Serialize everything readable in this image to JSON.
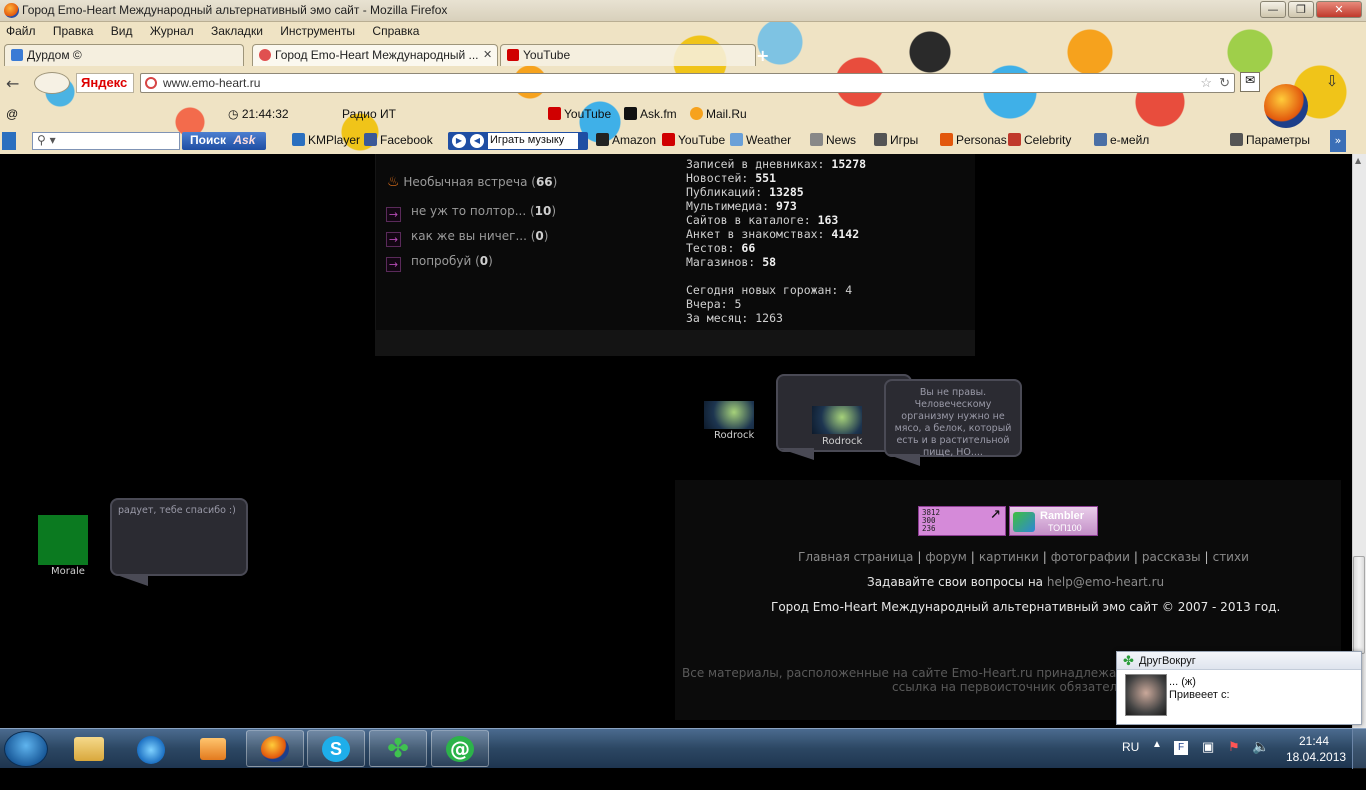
{
  "window": {
    "title": "Город Emo-Heart Международный альтернативный эмо сайт - Mozilla Firefox",
    "btn_min": "—",
    "btn_max": "❐",
    "btn_close": "✕"
  },
  "menu": [
    "Файл",
    "Правка",
    "Вид",
    "Журнал",
    "Закладки",
    "Инструменты",
    "Справка"
  ],
  "tabs": [
    {
      "label": "Дурдом ©",
      "color": "#3a7bd5"
    },
    {
      "label": "Город Emo-Heart Международный ...",
      "color": "#e05050"
    },
    {
      "label": "YouTube",
      "color": "#d00000"
    }
  ],
  "tab_close": "✕",
  "new_tab": "+",
  "nav": {
    "back": "←",
    "yandex": "Яндекс",
    "url": "www.emo-heart.ru"
  },
  "toolbar": {
    "time": "21:44:32",
    "radio": "Радио ИТ",
    "youtube": "YouTube",
    "askfm": "Ask.fm",
    "mailru": "Mail.Ru"
  },
  "search": {
    "placeholder": "▾",
    "button": "Поиск",
    "ask": "Ask"
  },
  "music": {
    "label": "Играть музыку"
  },
  "bookmarks": [
    {
      "label": "KMPlayer",
      "color": "#2a6fbf"
    },
    {
      "label": "Facebook",
      "color": "#3b5998"
    },
    {
      "label": "Amazon",
      "color": "#222222"
    },
    {
      "label": "YouTube",
      "color": "#d00000"
    },
    {
      "label": "Weather",
      "color": "#6aa0d8"
    },
    {
      "label": "News",
      "color": "#888888"
    },
    {
      "label": "Игры",
      "color": "#555555"
    },
    {
      "label": "Personas",
      "color": "#e2570c"
    },
    {
      "label": "Celebrity",
      "color": "#c0392b"
    },
    {
      "label": "е-мейл",
      "color": "#4a6fa5"
    },
    {
      "label": "Параметры",
      "color": "#555555"
    }
  ],
  "forum": {
    "topic": "Необычная встреча",
    "topic_count": "66",
    "items": [
      {
        "title": "не уж то полтор...",
        "count": "10"
      },
      {
        "title": "как же вы ничег...",
        "count": "0"
      },
      {
        "title": "попробуй",
        "count": "0"
      }
    ]
  },
  "stats": [
    {
      "label": "Записей в дневниках:",
      "value": "15278"
    },
    {
      "label": "Новостей:",
      "value": "551"
    },
    {
      "label": "Публикаций:",
      "value": "13285"
    },
    {
      "label": "Мультимедиа:",
      "value": "973"
    },
    {
      "label": "Сайтов в каталоге:",
      "value": "163"
    },
    {
      "label": "Анкет в знакомствах:",
      "value": "4142"
    },
    {
      "label": "Тестов:",
      "value": "66"
    },
    {
      "label": "Магазинов:",
      "value": "58"
    }
  ],
  "citizens": [
    {
      "label": "Сегодня новых горожан:",
      "value": "4"
    },
    {
      "label": "Вчера:",
      "value": "5"
    },
    {
      "label": "За месяц:",
      "value": "1263"
    }
  ],
  "chat": {
    "user1": "Rodrock",
    "user2": "Rodrock",
    "bubble1": "Вы не правы. Человеческому организму нужно не мясо, а белок, который есть и в растительной пище, НО....",
    "user3": "Morale",
    "bubble2": "радует, тебе спасибо :)"
  },
  "counters": {
    "liveinternet": [
      "3812",
      "300",
      "236"
    ],
    "rambler": "Rambler",
    "rambler_sub": "ТОП100"
  },
  "footer": {
    "links": [
      "Главная страница",
      "форум",
      "картинки",
      "фотографии",
      "рассказы",
      "стихи"
    ],
    "ask_text": "Задавайте свои вопросы на",
    "email": "help@emo-heart.ru",
    "copyright": "Город Emo-Heart Международный альтернативный эмо сайт © 2007 - 2013 год.",
    "disclaimer1": "Все материалы, расположенные на сайте Emo-Heart.ru принадлежат их а",
    "disclaimer2": "ссылка на первоисточник обязательн"
  },
  "notification": {
    "app": "ДругВокруг",
    "name": "... (ж)",
    "message": "Привееет с:"
  },
  "taskbar": {
    "lang": "RU",
    "time": "21:44",
    "date": "18.04.2013"
  }
}
